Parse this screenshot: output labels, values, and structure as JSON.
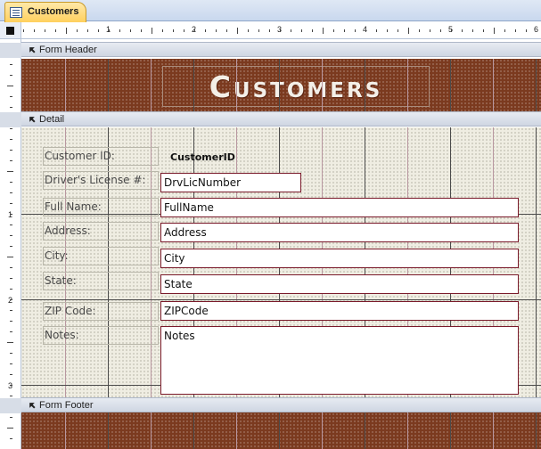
{
  "tab": {
    "label": "Customers",
    "icon": "form-icon"
  },
  "ruler": {
    "top_numbers": [
      "1",
      "2",
      "3",
      "4",
      "5",
      "6"
    ],
    "left_numbers": [
      "1",
      "2",
      "3"
    ]
  },
  "sections": {
    "header": "Form Header",
    "detail": "Detail",
    "footer": "Form Footer"
  },
  "header": {
    "title": "Customers"
  },
  "detail": {
    "labels": {
      "customer_id": "Customer ID:",
      "drivers_license": "Driver's License #:",
      "full_name": "Full Name:",
      "address": "Address:",
      "city": "City:",
      "state": "State:",
      "zip": "ZIP Code:",
      "notes": "Notes:"
    },
    "fields": {
      "customer_id": "CustomerID",
      "drivers_license": "DrvLicNumber",
      "full_name": "FullName",
      "address": "Address",
      "city": "City",
      "state": "State",
      "zip": "ZIPCode",
      "notes": "Notes"
    }
  },
  "colors": {
    "header_bg": "#7b3a1f",
    "detail_bg": "#efede2",
    "field_border": "#7a1a2a",
    "tab_bg": "#ffd05e"
  }
}
